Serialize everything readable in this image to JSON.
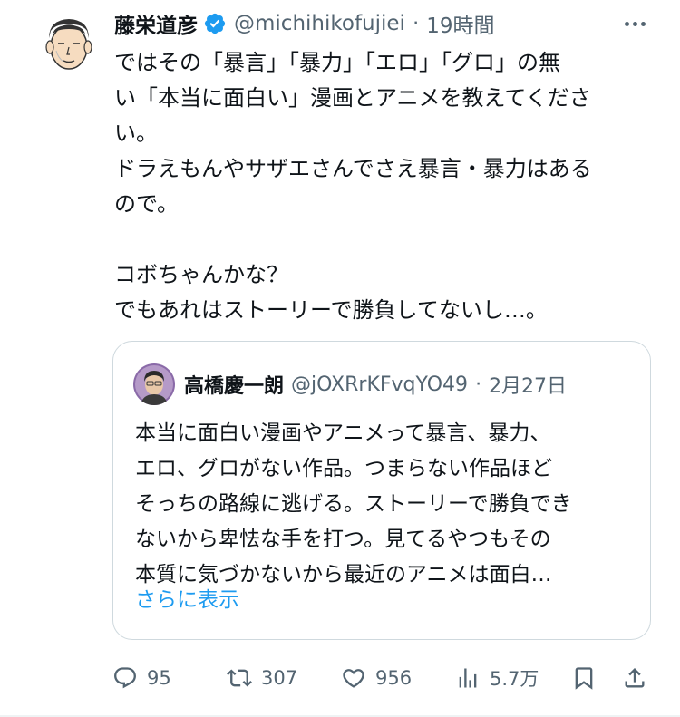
{
  "tweet": {
    "author_name": "藤栄道彦",
    "handle": "@michihikofujiei",
    "time": "19時間",
    "separator": "·",
    "lines": [
      "ではその「暴言」「暴力」「エロ」「グロ」の無",
      "い「本当に面白い」漫画とアニメを教えてくださ",
      "い。",
      "ドラえもんやサザエさんでさえ暴言・暴力はある",
      "ので。",
      "",
      "コボちゃんかな？",
      "でもあれはストーリーで勝負してないし…。"
    ]
  },
  "quote": {
    "author_name": "高橋慶一朗",
    "handle": "@jOXRrKFvqYO49",
    "date": "2月27日",
    "separator": "·",
    "lines": [
      "本当に面白い漫画やアニメって暴言、暴力、",
      "エロ、グロがない作品。つまらない作品ほど",
      "そっちの路線に逃げる。ストーリーで勝負でき",
      "ないから卑怯な手を打つ。見てるやつもその",
      "本質に気づかないから最近のアニメは面白…"
    ],
    "show_more": "さらに表示"
  },
  "actions": {
    "replies": "95",
    "retweets": "307",
    "likes": "956",
    "views": "5.7万"
  },
  "icons": {
    "verified": "verified-badge-icon",
    "more": "more-icon",
    "reply": "reply-icon",
    "retweet": "retweet-icon",
    "like": "heart-icon",
    "views": "views-icon",
    "bookmark": "bookmark-icon",
    "share": "share-icon"
  },
  "colors": {
    "text": "#0f1419",
    "secondary": "#536471",
    "link": "#1d9bf0",
    "verified": "#1d9bf0",
    "border": "#cfd9de"
  }
}
